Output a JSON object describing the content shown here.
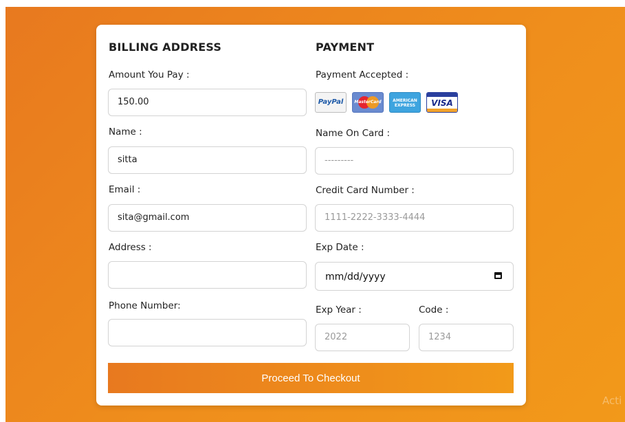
{
  "billing": {
    "title": "BILLING ADDRESS",
    "amount_label": "Amount You Pay :",
    "amount_value": "150.00",
    "name_label": "Name :",
    "name_value": "sitta",
    "email_label": "Email :",
    "email_value": "sita@gmail.com",
    "address_label": "Address :",
    "address_value": "",
    "phone_label": "Phone Number:",
    "phone_value": ""
  },
  "payment": {
    "title": "PAYMENT",
    "accepted_label": "Payment Accepted :",
    "cards": [
      {
        "name": "PayPal",
        "text": "PayPal",
        "icon": "paypal-icon"
      },
      {
        "name": "MasterCard",
        "text": "MasterCard",
        "icon": "mastercard-icon"
      },
      {
        "name": "American Express",
        "text": "AMERICAN EXPRESS",
        "icon": "amex-icon"
      },
      {
        "name": "Visa",
        "text": "VISA",
        "icon": "visa-icon"
      }
    ],
    "name_on_card_label": "Name On Card :",
    "name_on_card_placeholder": "---------",
    "card_number_label": "Credit Card Number :",
    "card_number_placeholder": "1111-2222-3333-4444",
    "exp_date_label": "Exp Date :",
    "exp_date_placeholder": "mm/dd/yyyy",
    "exp_year_label": "Exp Year :",
    "exp_year_placeholder": "2022",
    "code_label": "Code :",
    "code_placeholder": "1234"
  },
  "checkout": {
    "button_label": "Proceed To Checkout"
  },
  "colors": {
    "accent_start": "#e8791f",
    "accent_end": "#f29a19"
  },
  "overlay": {
    "watermark": "Acti"
  }
}
